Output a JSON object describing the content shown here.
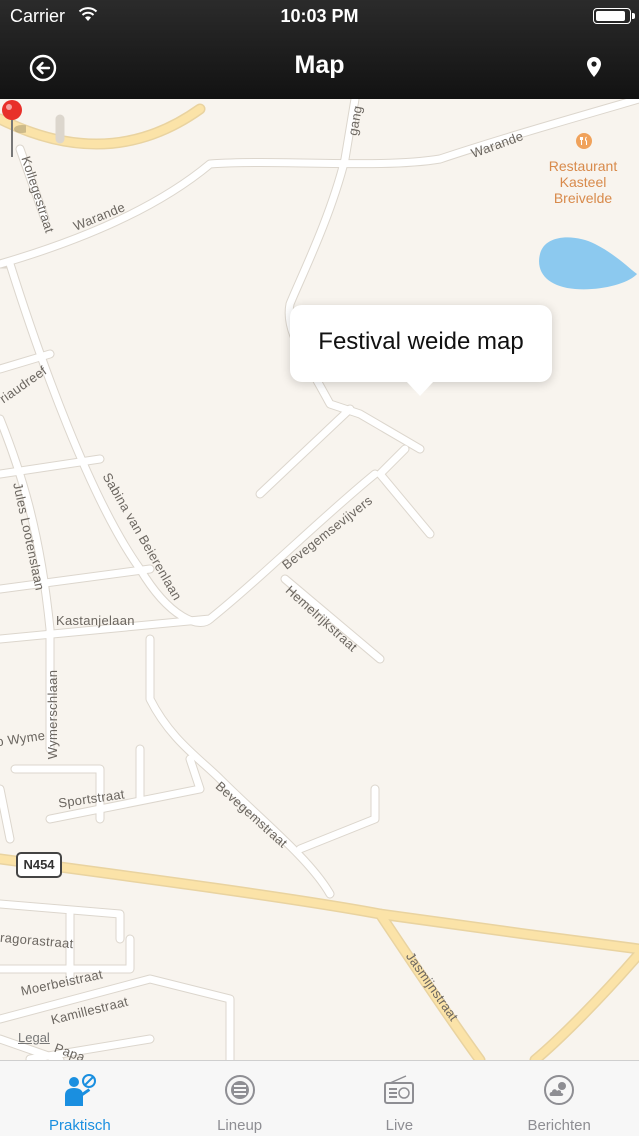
{
  "status_bar": {
    "carrier": "Carrier",
    "time": "10:03 PM",
    "battery_level": 0.92
  },
  "nav": {
    "title": "Map"
  },
  "map": {
    "callout_text": "Festival weide map",
    "poi": {
      "name_line1": "Restaurant",
      "name_line2": "Kasteel",
      "name_line3": "Breivelde"
    },
    "road_shield": "N454",
    "legal": "Legal",
    "street_labels": {
      "warande_top": "Warande",
      "warande_left": "Warande",
      "kollegestraat": "Kollegestraat",
      "gang": "gang",
      "riaudreef": "riaudreef",
      "jules": "Jules Lootenslaan",
      "sabina": "Sabina van Beierenlaan",
      "bevegemsevijvers": "Bevegemsevijvers",
      "hemelrijk": "Hemelrijkstraat",
      "kastanjelaan": "Kastanjelaan",
      "wymersch": "Wymerschlaan",
      "wyme": "o Wyme",
      "sportstraat": "Sportstraat",
      "bevegemstraat": "Bevegemstraat",
      "jasmijn": "Jasmijnstraat",
      "pythagoras": "ragorastraat",
      "moerbei": "Moerbeistraat",
      "kamille": "Kamillestraat",
      "papa": "Papa"
    },
    "colors": {
      "background": "#f8f4ee",
      "road": "#ffffff",
      "main_road": "#fbe3a8",
      "water": "#8cc9ef",
      "pin": "#e8302a"
    }
  },
  "tabs": [
    {
      "label": "Praktisch",
      "icon": "person-info-icon",
      "active": true
    },
    {
      "label": "Lineup",
      "icon": "globe-list-icon",
      "active": false
    },
    {
      "label": "Live",
      "icon": "radio-icon",
      "active": false
    },
    {
      "label": "Berichten",
      "icon": "weather-cloud-icon",
      "active": false
    }
  ]
}
